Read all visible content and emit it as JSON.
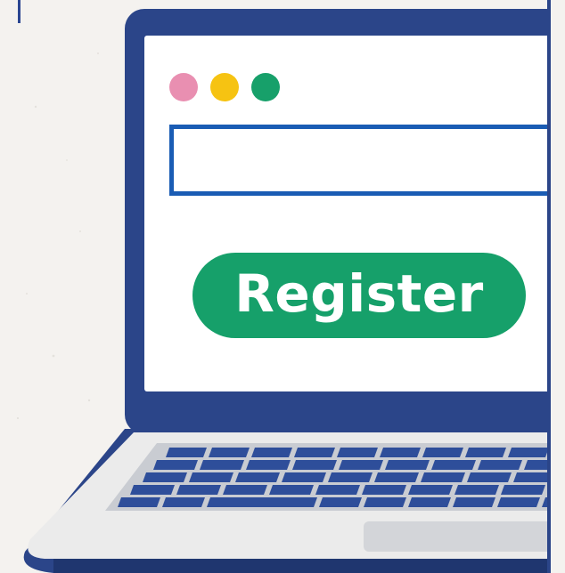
{
  "screen": {
    "window_dots": [
      {
        "name": "pink-dot",
        "color": "#e98fb1"
      },
      {
        "name": "yellow-dot",
        "color": "#f6c312"
      },
      {
        "name": "green-dot",
        "color": "#17a06a"
      }
    ],
    "address_field": {
      "value": "",
      "placeholder": ""
    },
    "register_button": {
      "label": "Register",
      "color": "#16a06a"
    }
  },
  "colors": {
    "bezel": "#2b4589",
    "field_border": "#1a5cb4",
    "keys": "#2e4e9a",
    "base": "#ebebeb"
  }
}
